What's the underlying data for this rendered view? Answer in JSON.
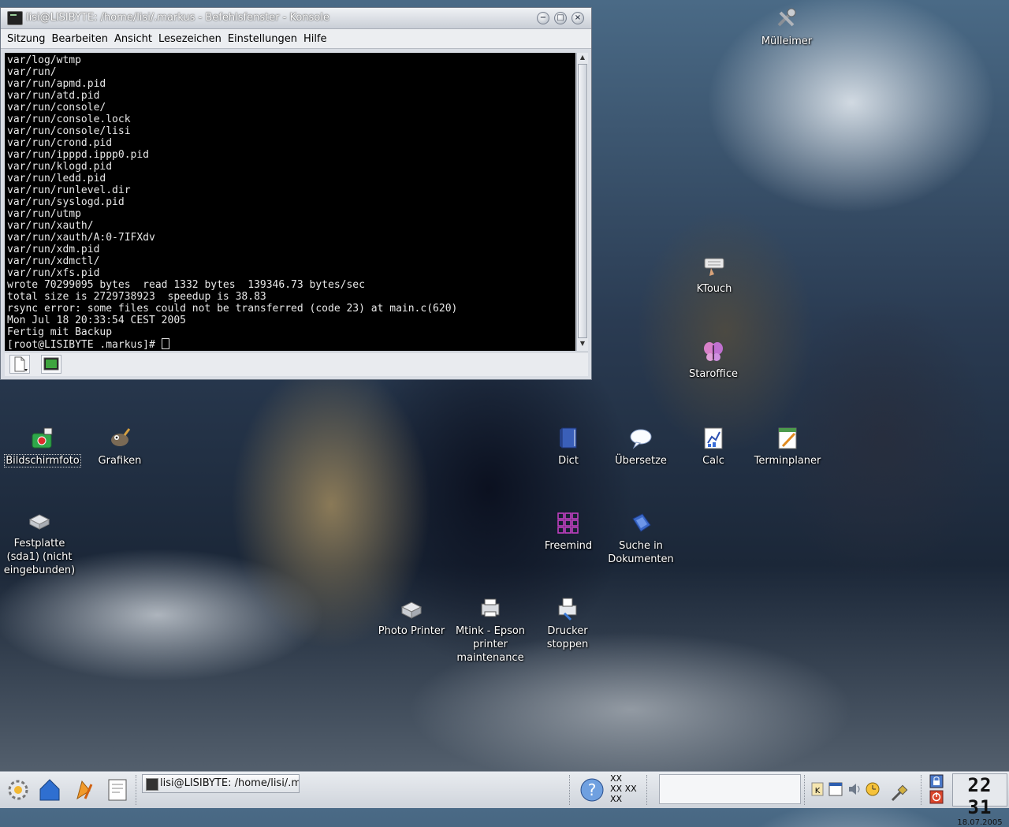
{
  "window": {
    "title": "lisi@LISIBYTE: /home/lisi/.markus - Befehlsfenster - Konsole",
    "buttons": {
      "minimize": "−",
      "maximize": "□",
      "close": "×"
    },
    "menu": [
      "Sitzung",
      "Bearbeiten",
      "Ansicht",
      "Lesezeichen",
      "Einstellungen",
      "Hilfe"
    ]
  },
  "terminal": {
    "lines": [
      "var/log/wtmp",
      "var/run/",
      "var/run/apmd.pid",
      "var/run/atd.pid",
      "var/run/console/",
      "var/run/console.lock",
      "var/run/console/lisi",
      "var/run/crond.pid",
      "var/run/ipppd.ippp0.pid",
      "var/run/klogd.pid",
      "var/run/ledd.pid",
      "var/run/runlevel.dir",
      "var/run/syslogd.pid",
      "var/run/utmp",
      "var/run/xauth/",
      "var/run/xauth/A:0-7IFXdv",
      "var/run/xdm.pid",
      "var/run/xdmctl/",
      "var/run/xfs.pid",
      "wrote 70299095 bytes  read 1332 bytes  139346.73 bytes/sec",
      "total size is 2729738923  speedup is 38.83",
      "rsync error: some files could not be transferred (code 23) at main.c(620)",
      "Mon Jul 18 20:33:54 CEST 2005",
      "Fertig mit Backup"
    ],
    "prompt": "[root@LISIBYTE .markus]# "
  },
  "desktop": {
    "muelleimer": "Mülleimer",
    "ktouch": "KTouch",
    "staroffice": "Staroffice",
    "bildschirmfoto": "Bildschirmfoto",
    "grafiken": "Grafiken",
    "festplatte_1": "Festplatte",
    "festplatte_2": "(sda1) (nicht",
    "festplatte_3": "eingebunden)",
    "dict": "Dict",
    "uebersetze": "Übersetze",
    "calc": "Calc",
    "terminplaner": "Terminplaner",
    "freemind": "Freemind",
    "suche_1": "Suche in",
    "suche_2": "Dokumenten",
    "photo_printer": "Photo Printer",
    "mtink_1": "Mtink - Epson",
    "mtink_2": "printer",
    "mtink_3": "maintenance",
    "drucker_1": "Drucker",
    "drucker_2": "stoppen"
  },
  "taskbar": {
    "task_label": "lisi@LISIBYTE: /home/lisi/.m",
    "pager": [
      "XX",
      "XX XX",
      "XX"
    ],
    "clock_time": "22 31",
    "clock_date": "18.07.2005"
  }
}
